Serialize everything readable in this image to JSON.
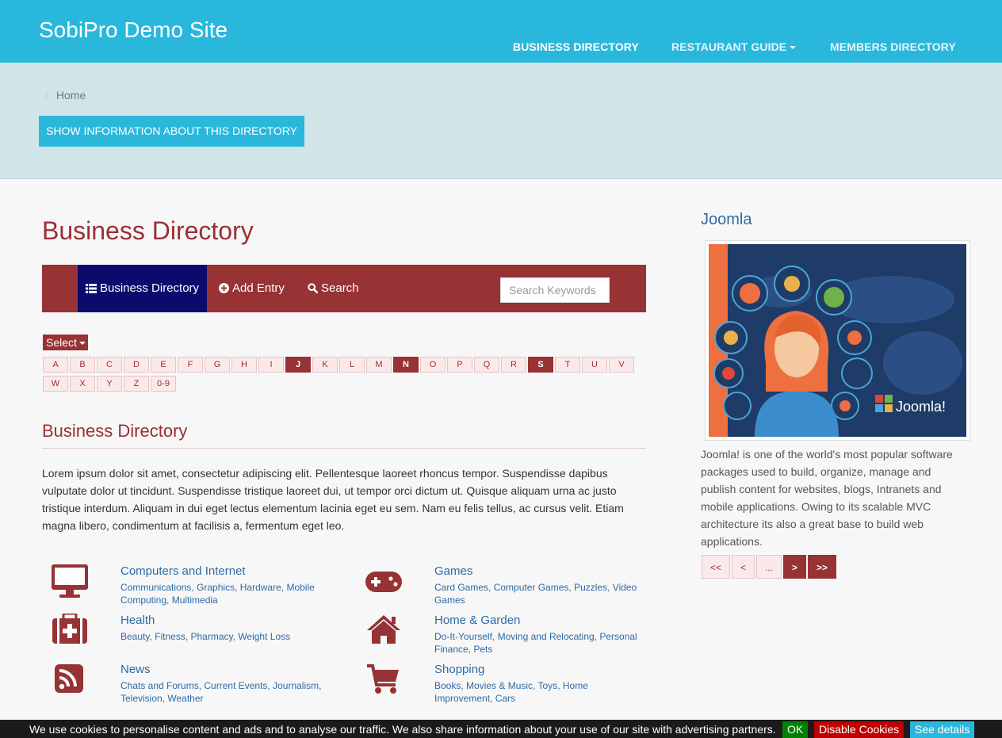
{
  "site": {
    "brand": "SobiPro Demo Site",
    "nav": [
      {
        "label": "BUSINESS DIRECTORY"
      },
      {
        "label": "RESTAURANT GUIDE"
      },
      {
        "label": "MEMBERS DIRECTORY"
      }
    ]
  },
  "header": {
    "breadcrumb_sep": "/",
    "breadcrumb_home": "Home",
    "info_button": "SHOW INFORMATION ABOUT THIS DIRECTORY"
  },
  "main": {
    "title": "Business Directory",
    "toolbar": {
      "directory_label": "Business Directory",
      "add_entry_label": "Add Entry",
      "search_label": "Search",
      "search_placeholder": "Search Keywords"
    },
    "select_label": "Select",
    "alphabet": [
      "A",
      "B",
      "C",
      "D",
      "E",
      "F",
      "G",
      "H",
      "I",
      "J",
      "K",
      "L",
      "M",
      "N",
      "O",
      "P",
      "Q",
      "R",
      "S",
      "T",
      "U",
      "V",
      "W",
      "X",
      "Y",
      "Z",
      "0-9"
    ],
    "alphabet_active": [
      "J",
      "N",
      "S"
    ],
    "section_title": "Business Directory",
    "description": "Lorem ipsum dolor sit amet, consectetur adipiscing elit. Pellentesque laoreet rhoncus tempor. Suspendisse dapibus vulputate dolor ut tincidunt. Suspendisse tristique laoreet dui, ut tempor orci dictum ut. Quisque aliquam urna ac justo tristique interdum. Aliquam in dui eget lectus elementum lacinia eget eu sem. Nam eu felis tellus, ac cursus velit. Etiam magna libero, condimentum at facilisis a, fermentum eget leo.",
    "categories": [
      {
        "title": "Computers and Internet",
        "icon": "monitor-icon",
        "subs": [
          "Communications",
          "Graphics",
          "Hardware",
          "Mobile Computing",
          "Multimedia"
        ]
      },
      {
        "title": "Games",
        "icon": "gamepad-icon",
        "subs": [
          "Card Games",
          "Computer Games",
          "Puzzles",
          "Video Games"
        ]
      },
      {
        "title": "Health",
        "icon": "medkit-icon",
        "subs": [
          "Beauty",
          "Fitness",
          "Pharmacy",
          "Weight Loss"
        ]
      },
      {
        "title": "Home & Garden",
        "icon": "home-icon",
        "subs": [
          "Do-It-Yourself",
          "Moving and Relocating",
          "Personal Finance",
          "Pets"
        ]
      },
      {
        "title": "News",
        "icon": "rss-icon",
        "subs": [
          "Chats and Forums",
          "Current Events",
          "Journalism",
          "Television",
          "Weather"
        ]
      },
      {
        "title": "Shopping",
        "icon": "cart-icon",
        "subs": [
          "Books, Movies & Music",
          "Toys",
          "Home Improvement",
          "Cars"
        ]
      }
    ]
  },
  "sidebar": {
    "title": "Joomla",
    "image_logo_text": "Joomla!",
    "text": "Joomla! is one of the world's most popular software packages used to build, organize, manage and publish content for websites, blogs, Intranets and mobile applications. Owing to its scalable MVC architecture its also a great base to build web applications.",
    "pager": [
      "<<",
      "<",
      "...",
      ">",
      ">>"
    ]
  },
  "cookie": {
    "text": "We use cookies to personalise content and ads and to analyse our traffic. We also share information about your use of our site with advertising partners.",
    "ok": "OK",
    "disable": "Disable Cookies",
    "details": "See details"
  },
  "colors": {
    "primary": "#29b8dc",
    "brand_red": "#973235",
    "active_navy": "#0b0b6e",
    "cookie_ok": "#008000",
    "cookie_disable": "#c00000"
  }
}
